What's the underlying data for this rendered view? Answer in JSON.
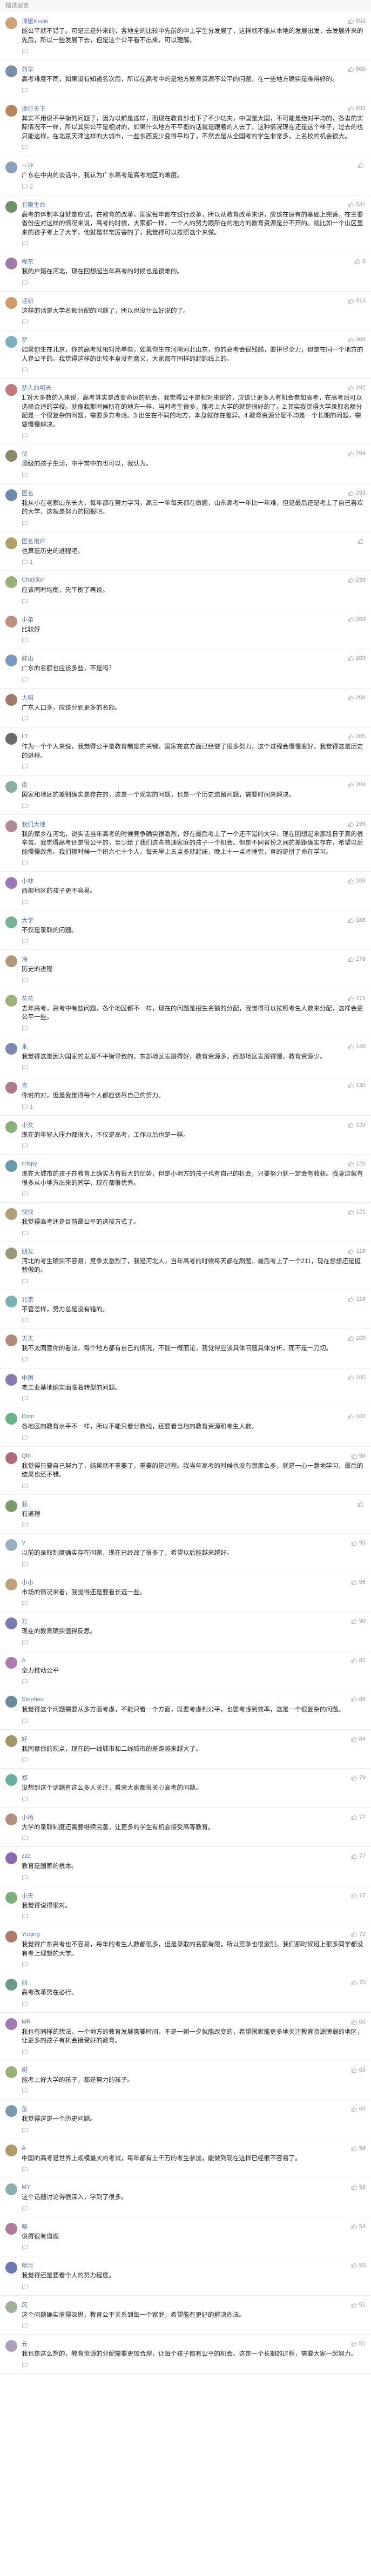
{
  "section_title": "精选留言",
  "icons": {
    "like": "thumbs-up-icon",
    "reply": "comment-bubble-icon"
  },
  "comments": [
    {
      "user": "谭媛Kevin",
      "avatar_color": "#c9a27a",
      "likes": "853",
      "replies": "",
      "text": "能公平就不错了。可是三是外来的，各地全的比较中先前的中上学生分发展了，这样就不能从本地的发展出发，去发展外来的先后，所以一些发展下去，但是这个公平看不出来，可以理解。"
    },
    {
      "user": "刘华",
      "avatar_color": "#7a8fa8",
      "likes": "800",
      "replies": "",
      "text": "高考难度不同，如果没有知道名次后，所以在高考中的是地方教育资源不公平的问题，在一些地方确实是难得好的。"
    },
    {
      "user": "漫灯天下",
      "avatar_color": "#b8865c",
      "likes": "693",
      "replies": "",
      "text": "其实不用说不平衡的问题了，因为以前是这样，而现在教育部也下了不少功夫，中国是大国，不可能是绝对平均的，各省的实际情况不一样，所以其实公平是相对的，如果什么地方不平衡的话就是跟着的人去了，这种情况现在还是这个样子，过去的也只能这样，在北京天津这样的大城市，一些东西变少变得平均了，不然去是从全国考的学生非常多，上名校的机会很大。"
    },
    {
      "user": "一冲",
      "avatar_color": "#8aa0b8",
      "likes": "",
      "replies": "2",
      "text": "广东在中央的谈话中，我认为广东高考是高考地区的难度。"
    },
    {
      "user": "有限生命",
      "avatar_color": "#6f8f6a",
      "likes": "531",
      "replies": "",
      "text": "高考的体制本身就是应试，在教育的改革，国家每年都在试行改革，所以从教育改革来讲，应该在原有的基础上完善，在主要省份应对这样的情况来说，高考的时候，大家都一样，一个人的努力跟所在的地方的教育资源是分不开的。就比如一个山区里来的孩子考上了大学，他就是非常厉害的了，我觉得可以按照这个来做。"
    },
    {
      "user": "程东",
      "avatar_color": "#a07aa8",
      "likes": "3",
      "replies": "",
      "text": "我的户籍在河北，现在回想起当年高考的时候也是很难的。"
    },
    {
      "user": "迎新",
      "avatar_color": "#d09a6a",
      "likes": "316",
      "replies": "",
      "text": "这样的话是大学名额分配的问题了，所以也没什么好说的了。"
    },
    {
      "user": "梦",
      "avatar_color": "#7ab0c0",
      "likes": "306",
      "replies": "",
      "text": "如果你生在北京，你的高考就相对简单些，如果你生在河南河北山东，你的高考会很残酷，要拼尽全力，但是在同一个地方的人是公平的。我觉得这样的比较本身没有意义，大家都在同样的起跑线上的。"
    },
    {
      "user": "梦人的明天",
      "avatar_color": "#c07a7a",
      "likes": "297",
      "replies": "",
      "text": "1.对大多数的人来说，高考其实是改变命运的机会，我觉得公平是相对来说的，应该让更多人有机会参加高考，在高考后可以选择合适的学校。就像我那时候所在的地方一样，当时考生很多，能考上大学的就是很好的了。2.其实我觉得大学录取名额分配是一个很复杂的问题，需要多方考虑。3.出生在不同的地方，本身就存在差异。4.教育资源分配不均是一个长期的问题，需要慢慢解决。"
    },
    {
      "user": "伏",
      "avatar_color": "#8a8a6a",
      "likes": "294",
      "replies": "",
      "text": "顶级的孩子生活，中平常中的也可以，我认为。"
    },
    {
      "user": "匿名",
      "avatar_color": "#6a8ab0",
      "likes": "293",
      "replies": "",
      "text": "我从小在老家山东长大，每年都在努力学习，高三一年每天都在做题，山东高考一年比一年难，但是最后还是考上了自己喜欢的大学，这就是努力的回报吧。"
    },
    {
      "user": "匿名用户",
      "avatar_color": "#b0a06a",
      "likes": "",
      "replies": "1",
      "text": "也算是历史的进程吧。"
    },
    {
      "user": "Chatillon",
      "avatar_color": "#9ab07a",
      "likes": "239",
      "replies": "",
      "text": "应该同时均衡，先平衡了再说。"
    },
    {
      "user": "小弟",
      "avatar_color": "#c0907a",
      "likes": "209",
      "replies": "",
      "text": "比较好"
    },
    {
      "user": "醉山",
      "avatar_color": "#7a9ac0",
      "likes": "209",
      "replies": "",
      "text": "广东的名额也应该多些，不是吗？"
    },
    {
      "user": "大明",
      "avatar_color": "#a07a6a",
      "likes": "208",
      "replies": "",
      "text": "广东人口多，应该分到更多的名额。"
    },
    {
      "user": "LT",
      "avatar_color": "#6a6a6a",
      "likes": "205",
      "replies": "",
      "text": "作为一个个人来说，我觉得公平是教育制度的关键，国家在这方面已经做了很多努力，这个过程会慢慢变好。我觉得这是历史的进程。"
    },
    {
      "user": "南",
      "avatar_color": "#8ab0a0",
      "likes": "204",
      "replies": "",
      "text": "国家和地区的差别确实是存在的，这是一个现实的问题，也是一个历史遗留问题，需要时间来解决。"
    },
    {
      "user": "我们大地",
      "avatar_color": "#b08a9a",
      "likes": "195",
      "replies": "",
      "text": "我的家乡在河北，说实话当年高考的时候竞争确实很激烈，好在最后考上了一个还不错的大学，现在回想起来那段日子真的很辛苦。我觉得高考还是很公平的，至少给了我们这些普通家庭的孩子一个机会。但是不同省份之间的差距确实存在，希望以后能慢慢改善。我们那时候一个班六七十个人，每天早上五点多就起床，晚上十一点才睡觉，真的是拼了命在学习。"
    },
    {
      "user": "小林",
      "avatar_color": "#9a7ab0",
      "likes": "188",
      "replies": "",
      "text": "西部地区的孩子更不容易。"
    },
    {
      "user": "大学",
      "avatar_color": "#7ab09a",
      "likes": "188",
      "replies": "",
      "text": "不仅是录取的问题。"
    },
    {
      "user": "海",
      "avatar_color": "#b09a7a",
      "likes": "178",
      "replies": "",
      "text": "历史的进程"
    },
    {
      "user": "花花",
      "avatar_color": "#a0b07a",
      "likes": "171",
      "replies": "",
      "text": "去年高考，高考中有些问题，各个地区都不一样，现在的问题是招生名额的分配，我觉得可以按照考生人数来分配，这样会更公平一些。"
    },
    {
      "user": "朱",
      "avatar_color": "#7a8ab0",
      "likes": "148",
      "replies": "",
      "text": "我觉得这是因为国家的发展不平衡导致的，东部地区发展得好，教育资源多，西部地区发展得慢，教育资源少。"
    },
    {
      "user": "言",
      "avatar_color": "#b07a8a",
      "likes": "130",
      "replies": "1",
      "text": "你说的对，但是我觉得每个人都应该尽自己的努力。"
    },
    {
      "user": "小文",
      "avatar_color": "#8ab07a",
      "likes": "126",
      "replies": "",
      "text": "现在的年轻人压力都很大，不仅是高考，工作以后也是一样。"
    },
    {
      "user": "crispy",
      "avatar_color": "#6a9ab0",
      "likes": "126",
      "replies": "",
      "text": "现在大城市的孩子在教育上确实占有很大的优势，但是小地方的孩子也有自己的机会，只要努力就一定会有收获。我身边就有很多从小地方出来的同学，现在都很优秀。"
    },
    {
      "user": "快快",
      "avatar_color": "#b0a07a",
      "likes": "121",
      "replies": "",
      "text": "我觉得高考还是目前最公平的选拔方式了。"
    },
    {
      "user": "朋友",
      "avatar_color": "#9a9a7a",
      "likes": "118",
      "replies": "",
      "text": "河北的考生确实不容易，竞争太激烈了，我是河北人，当年高考的时候每天都在刷题，最后考上了一个211，现在想想还是挺骄傲的。"
    },
    {
      "user": "北京",
      "avatar_color": "#7ab0b0",
      "likes": "116",
      "replies": "",
      "text": "不管怎样，努力总是没有错的。"
    },
    {
      "user": "天天",
      "avatar_color": "#b08a7a",
      "likes": "109",
      "replies": "",
      "text": "我不太同意你的看法，每个地方都有自己的情况，不能一概而论，我觉得应该具体问题具体分析，而不是一刀切。"
    },
    {
      "user": "中国",
      "avatar_color": "#8a7ab0",
      "likes": "105",
      "replies": "",
      "text": "老工业基地确实面临着转型的问题。"
    },
    {
      "user": "Dom",
      "avatar_color": "#6ab08a",
      "likes": "102",
      "replies": "",
      "text": "各地区的教育水平不一样，所以不能只看分数线，还要看当地的教育资源和考生人数。"
    },
    {
      "user": "Qin",
      "avatar_color": "#b06a7a",
      "likes": "98",
      "replies": "",
      "text": "我觉得只要自己努力了，结果就不重要了，重要的是过程。我当年高考的时候也没有想那么多，就是一心一意地学习，最后的结果也还不错。"
    },
    {
      "user": "我",
      "avatar_color": "#7a9a6a",
      "likes": "",
      "replies": "",
      "text": "有道理"
    },
    {
      "user": "V",
      "avatar_color": "#9ab0c0",
      "likes": "95",
      "replies": "",
      "text": "以前的录取制度确实存在问题，现在已经改了很多了，希望以后能越来越好。"
    },
    {
      "user": "小小",
      "avatar_color": "#c0a07a",
      "likes": "95",
      "replies": "",
      "text": "市场的情况来看，我觉得还是要看长远一些。"
    },
    {
      "user": "万",
      "avatar_color": "#7a7ab0",
      "likes": "90",
      "replies": "",
      "text": "现在的教育确实值得反思。"
    },
    {
      "user": "A",
      "avatar_color": "#b07ab0",
      "likes": "87",
      "replies": "",
      "text": "全力推动公平"
    },
    {
      "user": "Stephen",
      "avatar_color": "#6a8a9a",
      "likes": "86",
      "replies": "",
      "text": "我觉得这个问题需要从多方面考虑，不能只看一个方面，既要考虑到公平，也要考虑到效率，这是一个很复杂的问题。"
    },
    {
      "user": "好",
      "avatar_color": "#a09a6a",
      "likes": "84",
      "replies": "",
      "text": "我同意你的观点，现在的一线城市和二线城市的差距越来越大了。"
    },
    {
      "user": "郑",
      "avatar_color": "#6ab0a0",
      "likes": "79",
      "replies": "",
      "text": "没想到这个话题有这么多人关注，看来大家都很关心高考的问题。"
    },
    {
      "user": "小杨",
      "avatar_color": "#b0907a",
      "likes": "77",
      "replies": "",
      "text": "大学的录取制度还需要继续完善，让更多的学生有机会接受高等教育。"
    },
    {
      "user": "zzz",
      "avatar_color": "#8a6ab0",
      "likes": "77",
      "replies": "",
      "text": "教育是国家的根本。"
    },
    {
      "user": "小天",
      "avatar_color": "#7ab07a",
      "likes": "72",
      "replies": "",
      "text": "我觉得说得很对。"
    },
    {
      "user": "Yuqing",
      "avatar_color": "#b07a6a",
      "likes": "72",
      "replies": "",
      "text": "我觉得广东高考也不容易，每年的考生人数都很多，但是录取的名额有限，所以竞争也很激烈。我们那时候班上很多同学都没有考上理想的大学。"
    },
    {
      "user": "丽",
      "avatar_color": "#6a9a8a",
      "likes": "70",
      "replies": "",
      "text": "高考改革势在必行。"
    },
    {
      "user": "MR",
      "avatar_color": "#a07ab0",
      "likes": "66",
      "replies": "",
      "text": "我也有同样的想法，一个地方的教育发展需要时间，不是一朝一夕就能改变的，希望国家能更多地关注教育资源薄弱的地区，让更多的孩子有机会接受好的教育。"
    },
    {
      "user": "明",
      "avatar_color": "#9ab07a",
      "likes": "63",
      "replies": "",
      "text": "能考上好大学的孩子，都是努力的孩子。"
    },
    {
      "user": "鱼",
      "avatar_color": "#7a9ab0",
      "likes": "60",
      "replies": "",
      "text": "我觉得这是一个历史问题。"
    },
    {
      "user": "A",
      "avatar_color": "#b09a6a",
      "likes": "58",
      "replies": "",
      "text": "中国的高考是世界上规模最大的考试，每年都有上千万的考生参加，能做到现在这样已经很不容易了。"
    },
    {
      "user": "MY",
      "avatar_color": "#8ab0b0",
      "likes": "58",
      "replies": "",
      "text": "这个话题讨论得很深入，学到了很多。"
    },
    {
      "user": "晓",
      "avatar_color": "#b07a9a",
      "likes": "54",
      "replies": "",
      "text": "说得很有道理"
    },
    {
      "user": "明月",
      "avatar_color": "#6a7ab0",
      "likes": "53",
      "replies": "",
      "text": "我觉得还是要看个人的努力程度。"
    },
    {
      "user": "风",
      "avatar_color": "#a0b09a",
      "likes": "51",
      "replies": "",
      "text": "这个问题确实值得深思，教育公平关系到每一个家庭，希望能有更好的解决办法。"
    },
    {
      "user": "云",
      "avatar_color": "#b0a0c0",
      "likes": "51",
      "replies": "",
      "text": "我也是这么想的，教育资源的分配需要更加合理，让每个孩子都有公平的机会。这是一个长期的过程，需要大家一起努力。"
    }
  ]
}
